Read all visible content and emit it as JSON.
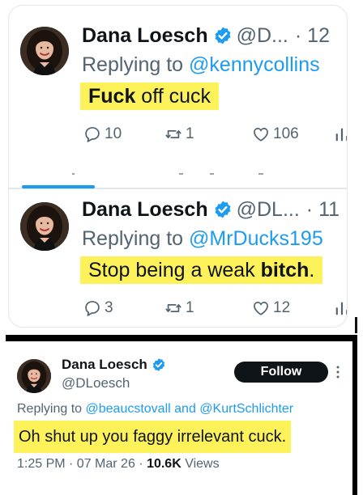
{
  "colors": {
    "accent": "#1d9bf0",
    "highlight": "#fdf25a",
    "muted": "#536471",
    "text": "#0f1419"
  },
  "tweet1": {
    "name": "Dana Loesch",
    "handle": "@D...",
    "time": "· 12",
    "replying_prefix": "Replying to",
    "replying_to": "@kennycollins",
    "text_bold": "Fuck",
    "text_rest": " off cuck",
    "replies": "10",
    "retweets": "1",
    "likes": "106"
  },
  "tweet2": {
    "name": "Dana Loesch",
    "handle": "@DL...",
    "time": "· 11",
    "replying_prefix": "Replying to",
    "replying_to": "@MrDucks195",
    "text_rest": "Stop being a weak ",
    "text_bold": "bitch",
    "text_end": ".",
    "replies": "3",
    "retweets": "1",
    "likes": "12"
  },
  "tweet3": {
    "name": "Dana Loesch",
    "handle": "@DLoesch",
    "follow_label": "Follow",
    "replying_prefix": "Replying to",
    "replying_to_1": "@beaucstovall",
    "replying_and": "and",
    "replying_to_2": "@KurtSchlichter",
    "text": "Oh shut up you faggy irrelevant cuck.",
    "timestamp": "1:25 PM · 07 Mar 26 · ",
    "views_count": "10.6K",
    "views_label": " Views"
  }
}
